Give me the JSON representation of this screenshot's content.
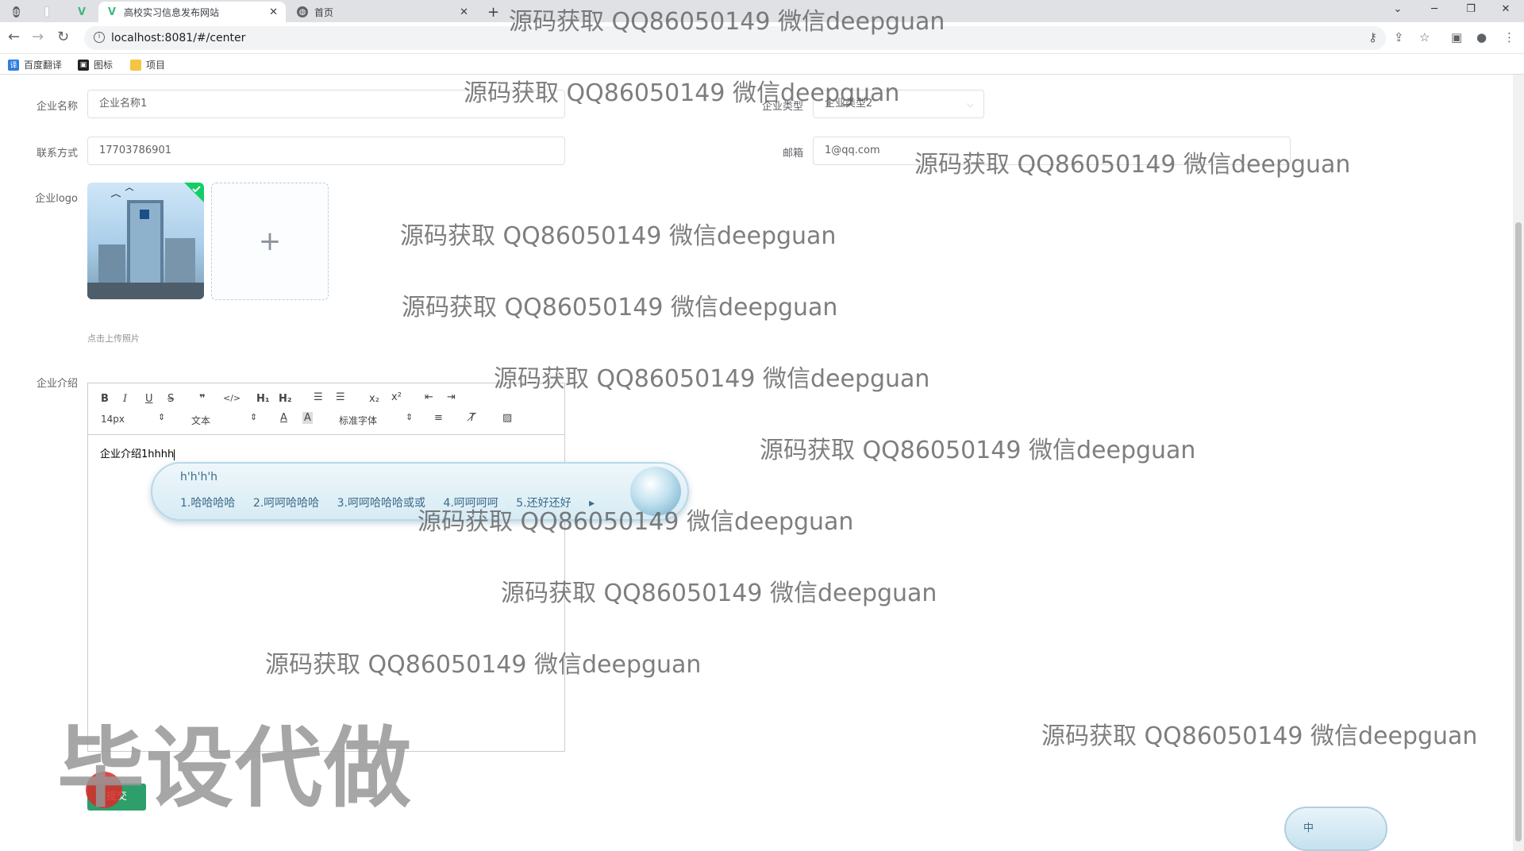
{
  "browser": {
    "tabs": [
      {
        "title": ""
      },
      {
        "title": ""
      },
      {
        "title": ""
      },
      {
        "title": "高校实习信息发布网站",
        "active": true
      },
      {
        "title": "首页"
      }
    ],
    "new_tab": "+",
    "url": "localhost:8081/#/center",
    "bookmarks": [
      "百度翻译",
      "图标",
      "项目"
    ]
  },
  "form": {
    "company_name_label": "企业名称",
    "company_name_value": "企业名称1",
    "company_type_label": "企业类型",
    "company_type_value": "企业类型2",
    "contact_label": "联系方式",
    "contact_value": "17703786901",
    "email_label": "邮箱",
    "email_value": "1@qq.com",
    "logo_label": "企业logo",
    "upload_tip": "点击上传照片",
    "intro_label": "企业介绍",
    "submit_label": "提交"
  },
  "editor": {
    "font_size": "14px",
    "block_format": "文本",
    "font_family": "标准字体",
    "content": "企业介绍1hhhh"
  },
  "ime": {
    "composition": "h'h'h'h",
    "candidates": [
      "1.哈哈哈哈",
      "2.呵呵哈哈哈",
      "3.呵呵哈哈哈或或",
      "4.呵呵呵呵",
      "5.还好还好"
    ],
    "mode": "中"
  },
  "watermarks": {
    "text": "源码获取 QQ86050149 微信deepguan",
    "big": "毕设代做"
  },
  "colors": {
    "primary_green": "#2e9e6b",
    "border": "#dcdfe6"
  }
}
